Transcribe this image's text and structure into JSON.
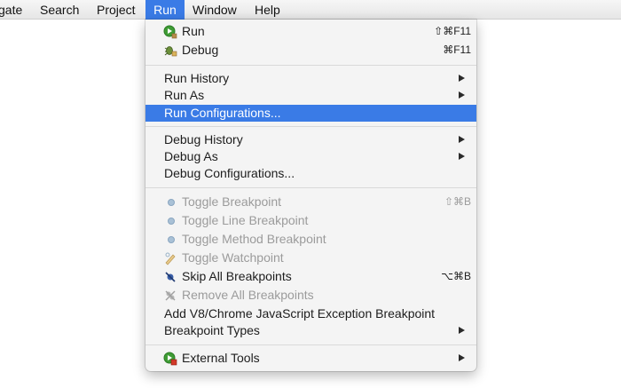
{
  "menubar": {
    "items": [
      "gate",
      "Search",
      "Project",
      "Run",
      "Window",
      "Help"
    ]
  },
  "run_menu": {
    "run": {
      "label": "Run",
      "shortcut": "⇧⌘F11"
    },
    "debug": {
      "label": "Debug",
      "shortcut": "⌘F11"
    },
    "run_history": {
      "label": "Run History"
    },
    "run_as": {
      "label": "Run As"
    },
    "run_configurations": {
      "label": "Run Configurations..."
    },
    "debug_history": {
      "label": "Debug History"
    },
    "debug_as": {
      "label": "Debug As"
    },
    "debug_configurations": {
      "label": "Debug Configurations..."
    },
    "toggle_breakpoint": {
      "label": "Toggle Breakpoint",
      "shortcut": "⇧⌘B"
    },
    "toggle_line_breakpoint": {
      "label": "Toggle Line Breakpoint"
    },
    "toggle_method_breakpoint": {
      "label": "Toggle Method Breakpoint"
    },
    "toggle_watchpoint": {
      "label": "Toggle Watchpoint"
    },
    "skip_all_breakpoints": {
      "label": "Skip All Breakpoints",
      "shortcut": "⌥⌘B"
    },
    "remove_all_breakpoints": {
      "label": "Remove All Breakpoints"
    },
    "add_v8_breakpoint": {
      "label": "Add V8/Chrome JavaScript Exception Breakpoint"
    },
    "breakpoint_types": {
      "label": "Breakpoint Types"
    },
    "external_tools": {
      "label": "External Tools"
    }
  },
  "colors": {
    "highlight": "#3a7be6",
    "menu_bg": "#f4f4f4",
    "disabled_text": "#9b9b9b"
  },
  "icons": [
    "run-icon",
    "debug-icon",
    "breakpoint-dot-icon",
    "watchpoint-icon",
    "skip-breakpoints-icon",
    "remove-breakpoints-icon",
    "external-tools-icon"
  ]
}
